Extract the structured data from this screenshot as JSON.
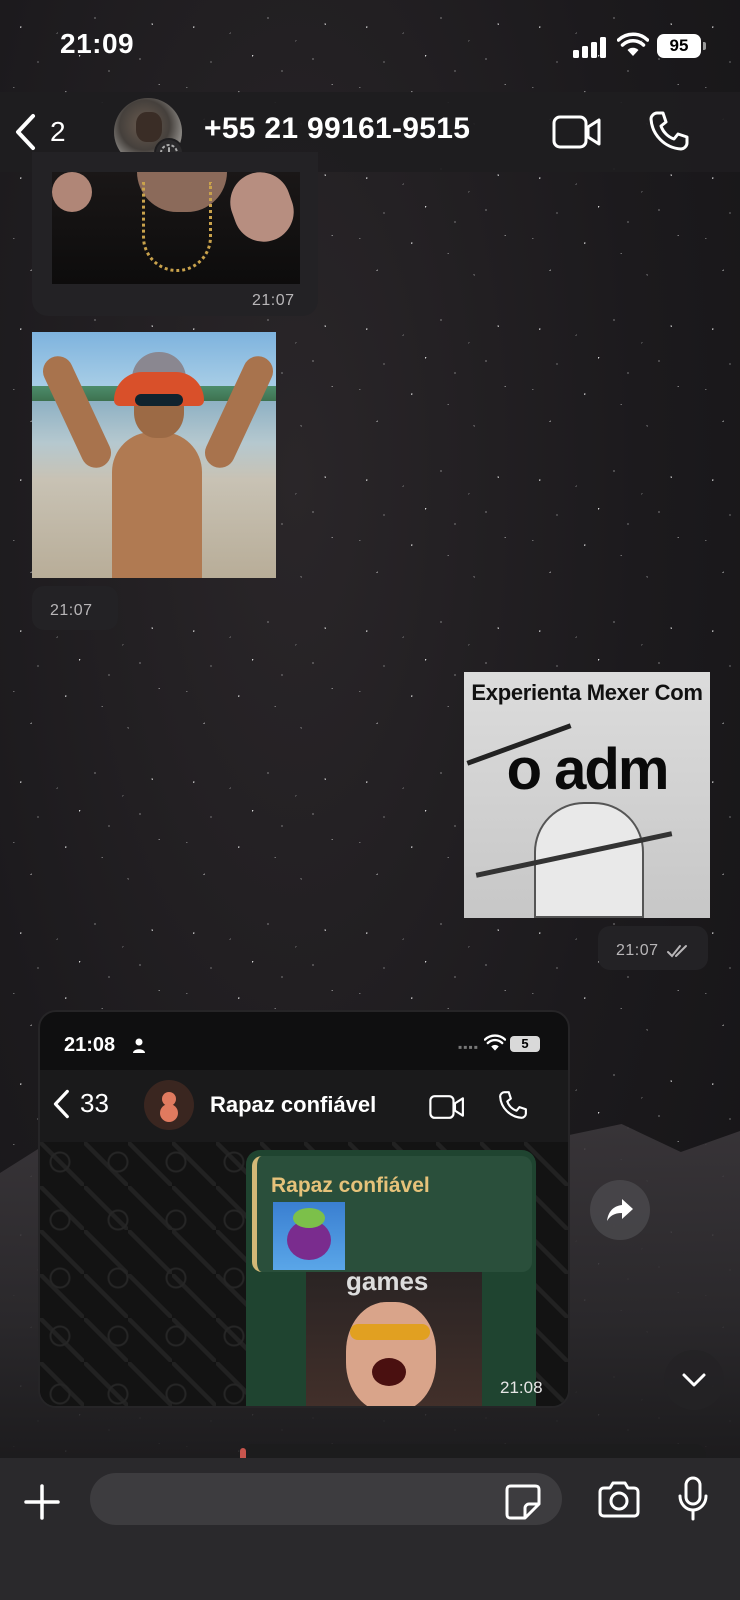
{
  "status_bar": {
    "time": "21:09",
    "battery": "95"
  },
  "header": {
    "back_count": "2",
    "contact": "+55 21 99161-9515"
  },
  "messages": [
    {
      "type": "image",
      "time": "21:07"
    },
    {
      "type": "sticker",
      "time": "21:07"
    },
    {
      "type": "sticker",
      "time": "21:07",
      "meme_top": "Experienta Mexer Com",
      "meme_big": "o adm",
      "status": "read"
    }
  ],
  "forwarded_screenshot": {
    "time": "21:08",
    "battery": "5",
    "back_count": "33",
    "chat_name": "Rapaz confiável",
    "quote_name": "Rapaz confiável",
    "media_text": "games",
    "media_time": "21:08"
  },
  "composer": {
    "placeholder": ""
  }
}
